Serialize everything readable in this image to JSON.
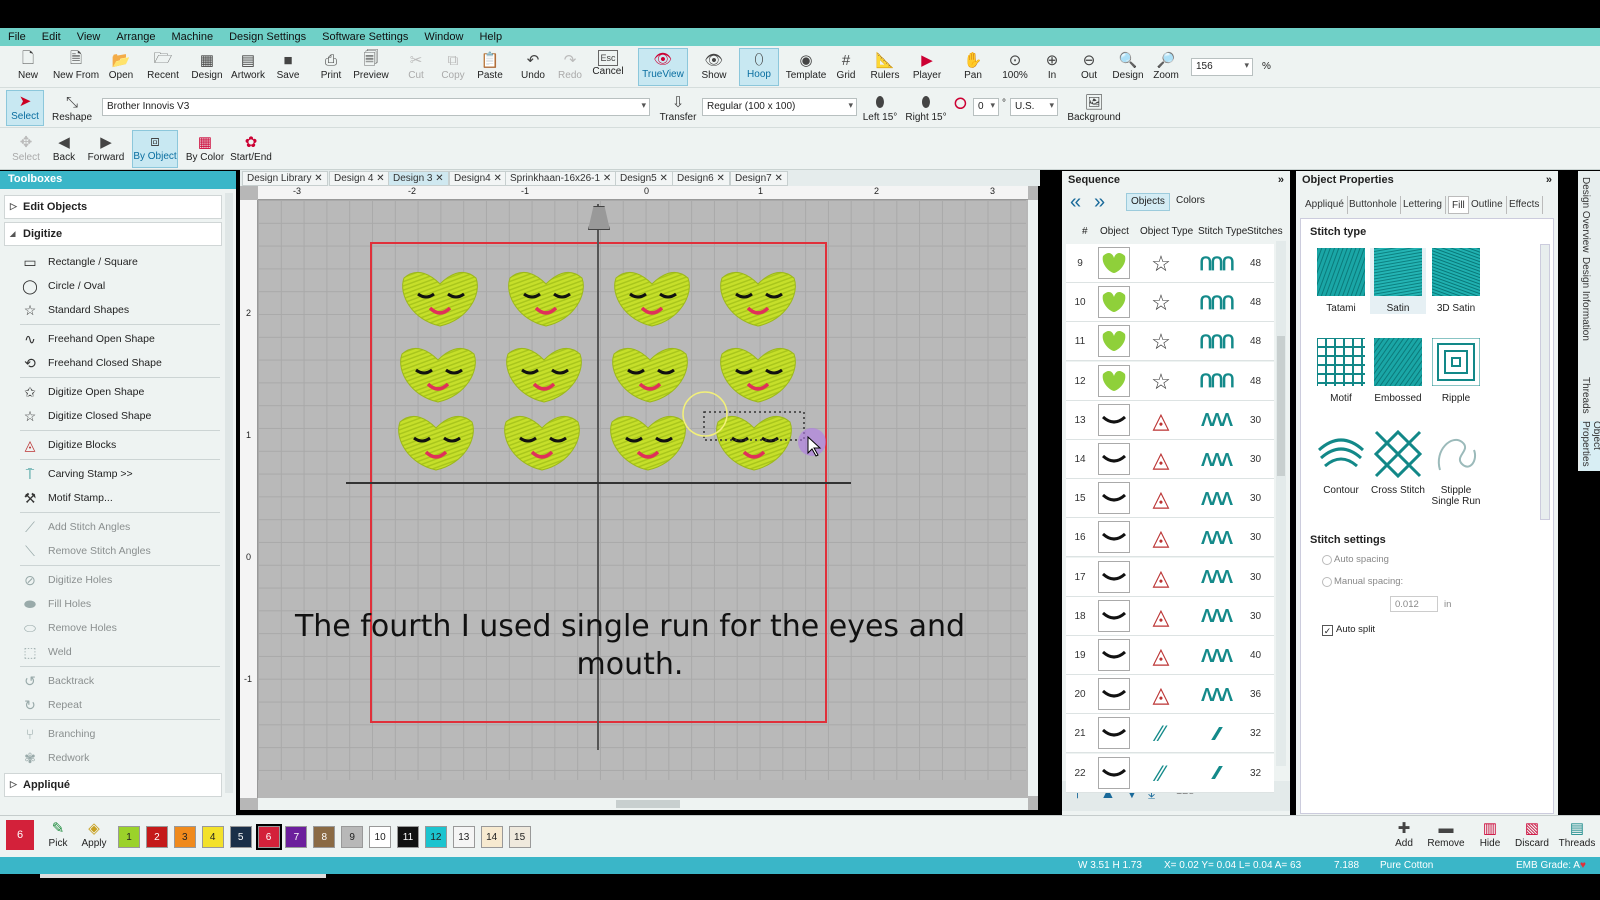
{
  "menu": [
    "File",
    "Edit",
    "View",
    "Arrange",
    "Machine",
    "Design Settings",
    "Software Settings",
    "Window",
    "Help"
  ],
  "toolbar1": {
    "items": [
      {
        "label": "New",
        "icon": "new-file-icon"
      },
      {
        "label": "New From",
        "icon": "new-from-icon"
      },
      {
        "label": "Open",
        "icon": "open-folder-icon"
      },
      {
        "label": "Recent",
        "icon": "recent-icon"
      },
      {
        "label": "Design",
        "icon": "design-icon"
      },
      {
        "label": "Artwork",
        "icon": "artwork-icon"
      },
      {
        "label": "Save",
        "icon": "save-icon"
      },
      {
        "label": "Print",
        "icon": "print-icon"
      },
      {
        "label": "Preview",
        "icon": "preview-icon"
      },
      {
        "label": "Cut",
        "icon": "cut-icon"
      },
      {
        "label": "Copy",
        "icon": "copy-icon"
      },
      {
        "label": "Paste",
        "icon": "paste-icon"
      },
      {
        "label": "Undo",
        "icon": "undo-icon"
      },
      {
        "label": "Redo",
        "icon": "redo-icon"
      },
      {
        "label": "Cancel",
        "icon": "esc-icon"
      },
      {
        "label": "TrueView",
        "icon": "trueview-icon"
      },
      {
        "label": "Show",
        "icon": "show-icon"
      },
      {
        "label": "Hoop",
        "icon": "hoop-icon"
      },
      {
        "label": "Template",
        "icon": "template-icon"
      },
      {
        "label": "Grid",
        "icon": "grid-icon"
      },
      {
        "label": "Rulers",
        "icon": "rulers-icon"
      },
      {
        "label": "Player",
        "icon": "player-icon"
      },
      {
        "label": "Pan",
        "icon": "pan-icon"
      },
      {
        "label": "100%",
        "icon": "zoom-100-icon"
      },
      {
        "label": "In",
        "icon": "zoom-in-icon"
      },
      {
        "label": "Out",
        "icon": "zoom-out-icon"
      },
      {
        "label": "Design",
        "icon": "zoom-design-icon"
      },
      {
        "label": "Zoom",
        "icon": "zoom-icon"
      }
    ],
    "zoom_value": "156",
    "zoom_unit": "%"
  },
  "toolbar2": {
    "select_label": "Select",
    "reshape_label": "Reshape",
    "machine": "Brother Innovis V3",
    "transfer_label": "Transfer",
    "hoop_size": "Regular (100 x 100)",
    "left_label": "Left 15°",
    "right_label": "Right 15°",
    "angle_value": "0",
    "angle_unit": "°",
    "units": "U.S.",
    "background_label": "Background"
  },
  "toolbar3": {
    "select_label": "Select",
    "back_label": "Back",
    "forward_label": "Forward",
    "byobject_label": "By Object",
    "bycolor_label": "By Color",
    "startend_label": "Start/End"
  },
  "toolboxes": {
    "title": "Toolboxes",
    "edit_objects": "Edit Objects",
    "digitize": "Digitize",
    "items": [
      "Rectangle / Square",
      "Circle / Oval",
      "Standard Shapes",
      "Freehand Open Shape",
      "Freehand Closed Shape",
      "Digitize Open Shape",
      "Digitize Closed Shape",
      "Digitize Blocks",
      "Carving Stamp >>",
      "Motif Stamp...",
      "Add Stitch Angles",
      "Remove Stitch Angles",
      "Digitize Holes",
      "Fill Holes",
      "Remove Holes",
      "Weld",
      "Backtrack",
      "Repeat",
      "Branching",
      "Redwork"
    ],
    "applique": "Appliqué"
  },
  "tabs": [
    "Design Library",
    "Design 4",
    "Design 3",
    "Design4",
    "Sprinkhaan-16x26-1",
    "Design5",
    "Design6",
    "Design7"
  ],
  "active_tab": "Design 3",
  "ruler_top": [
    "-3",
    "-2",
    "-1",
    "0",
    "1",
    "2",
    "3"
  ],
  "ruler_left": [
    "2",
    "1",
    "0",
    "-1"
  ],
  "caption": "The fourth I used single run for the eyes and mouth.",
  "sequence": {
    "title": "Sequence",
    "tab_objects": "Objects",
    "tab_colors": "Colors",
    "col_num": "#",
    "col_object": "Object",
    "col_type": "Object Type",
    "col_stitch": "Stitch Type",
    "col_stitches": "Stitches",
    "rows": [
      {
        "n": "9",
        "obj": "green-heart",
        "type": "star-icon",
        "stitch": "satin-icon",
        "count": "48"
      },
      {
        "n": "10",
        "obj": "green-heart",
        "type": "star-icon",
        "stitch": "satin-icon",
        "count": "48"
      },
      {
        "n": "11",
        "obj": "green-heart",
        "type": "star-icon",
        "stitch": "satin-icon",
        "count": "48"
      },
      {
        "n": "12",
        "obj": "green-heart",
        "type": "star-icon",
        "stitch": "satin-icon",
        "count": "48"
      },
      {
        "n": "13",
        "obj": "black-eye",
        "type": "blocks-icon",
        "stitch": "zigzag-icon",
        "count": "30"
      },
      {
        "n": "14",
        "obj": "black-eye",
        "type": "blocks-icon",
        "stitch": "zigzag-icon",
        "count": "30"
      },
      {
        "n": "15",
        "obj": "black-eye",
        "type": "blocks-icon",
        "stitch": "zigzag-icon",
        "count": "30"
      },
      {
        "n": "16",
        "obj": "black-eye",
        "type": "blocks-icon",
        "stitch": "zigzag-icon",
        "count": "30"
      },
      {
        "n": "17",
        "obj": "black-eye",
        "type": "blocks-icon",
        "stitch": "zigzag-icon",
        "count": "30"
      },
      {
        "n": "18",
        "obj": "black-eye",
        "type": "blocks-icon",
        "stitch": "zigzag-icon",
        "count": "30"
      },
      {
        "n": "19",
        "obj": "black-eye",
        "type": "blocks-icon",
        "stitch": "zigzag-icon",
        "count": "40"
      },
      {
        "n": "20",
        "obj": "black-eye",
        "type": "blocks-icon",
        "stitch": "zigzag-icon",
        "count": "36"
      },
      {
        "n": "21",
        "obj": "black-eye",
        "type": "run-icon",
        "stitch": "run-icon",
        "count": "32"
      },
      {
        "n": "22",
        "obj": "black-eye",
        "type": "run-icon",
        "stitch": "run-icon",
        "count": "32"
      }
    ]
  },
  "object_properties": {
    "title": "Object Properties",
    "tabs": [
      "Appliqué",
      "Buttonhole",
      "Lettering",
      "Fill",
      "Outline",
      "Effects"
    ],
    "active_tab": "Fill",
    "stitch_type_title": "Stitch type",
    "stitch_types": [
      "Tatami",
      "Satin",
      "3D Satin",
      "Motif",
      "Embossed",
      "Ripple",
      "Contour",
      "Cross Stitch",
      "Stipple Single Run"
    ],
    "selected_stitch": "Satin",
    "stitch_settings_title": "Stitch settings",
    "auto_spacing": "Auto spacing",
    "manual_spacing": "Manual spacing:",
    "spacing_value": "0.012",
    "spacing_unit": "in",
    "auto_split": "Auto split"
  },
  "right_tabs": [
    "Design Overview",
    "Design Information",
    "Threads",
    "Object Properties"
  ],
  "colorbar": {
    "current": "6",
    "pick_label": "Pick",
    "apply_label": "Apply",
    "chips": [
      {
        "n": "1",
        "c": "#9bd22a"
      },
      {
        "n": "2",
        "c": "#c41a1a"
      },
      {
        "n": "3",
        "c": "#f08a1c"
      },
      {
        "n": "4",
        "c": "#f3e12a"
      },
      {
        "n": "5",
        "c": "#1a2f48"
      },
      {
        "n": "6",
        "c": "#d3213a"
      },
      {
        "n": "7",
        "c": "#6c1f9c"
      },
      {
        "n": "8",
        "c": "#8a6a44"
      },
      {
        "n": "9",
        "c": "#b8b8b8"
      },
      {
        "n": "10",
        "c": "#ffffff"
      },
      {
        "n": "11",
        "c": "#111111"
      },
      {
        "n": "12",
        "c": "#1cc4cf"
      },
      {
        "n": "13",
        "c": "#f5f5f5"
      },
      {
        "n": "14",
        "c": "#f7ead0"
      },
      {
        "n": "15",
        "c": "#efe9dd"
      }
    ],
    "add_label": "Add",
    "remove_label": "Remove",
    "hide_label": "Hide",
    "discard_label": "Discard",
    "threads_label": "Threads"
  },
  "status": {
    "size": "W 3.51 H 1.73",
    "coords": "X= 0.02 Y= 0.04 L= 0.04 A= 63",
    "value": "7.188",
    "thread": "Pure Cotton",
    "grade": "EMB Grade: A"
  },
  "colors": {
    "accent": "#3ab6c8",
    "menu": "#6fd0c7",
    "hoop": "#e0303a",
    "fabric": "#b9b9b9",
    "stitch_green": "#c4dd2a",
    "stitch_teal": "#148a8a"
  }
}
